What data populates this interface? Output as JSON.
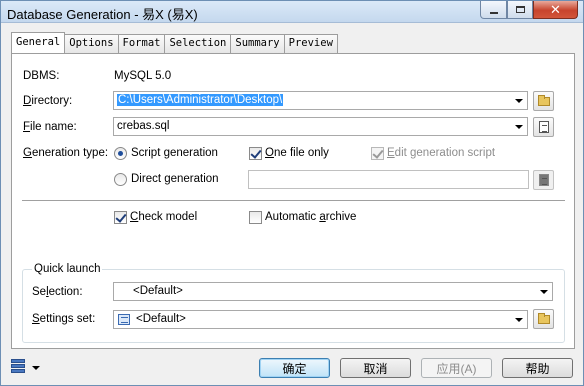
{
  "window": {
    "title": "Database Generation - 易X (易X)"
  },
  "tabs": [
    "General",
    "Options",
    "Format",
    "Selection",
    "Summary",
    "Preview"
  ],
  "general": {
    "dbms_label": "DBMS:",
    "dbms_value": "MySQL 5.0",
    "directory_label": "Directory:",
    "directory_value": "C:\\Users\\Administrator\\Desktop\\",
    "filename_label": "File name:",
    "filename_value": "crebas.sql",
    "gentype_label": "Generation type:",
    "script_generation": "Script generation",
    "direct_generation": "Direct generation",
    "one_file_only": "One file only",
    "edit_generation_script": "Edit generation script",
    "check_model": "Check model",
    "automatic_archive": "Automatic archive"
  },
  "quick_launch": {
    "title": "Quick launch",
    "selection_label": "Selection:",
    "selection_value": "<Default>",
    "settings_label": "Settings set:",
    "settings_value": "<Default>"
  },
  "buttons": {
    "ok": "确定",
    "cancel": "取消",
    "apply": "应用(A)",
    "help": "帮助"
  },
  "state": {
    "generation_type": "script",
    "one_file_only": true,
    "edit_generation_script": true,
    "check_model": true,
    "automatic_archive": false
  }
}
